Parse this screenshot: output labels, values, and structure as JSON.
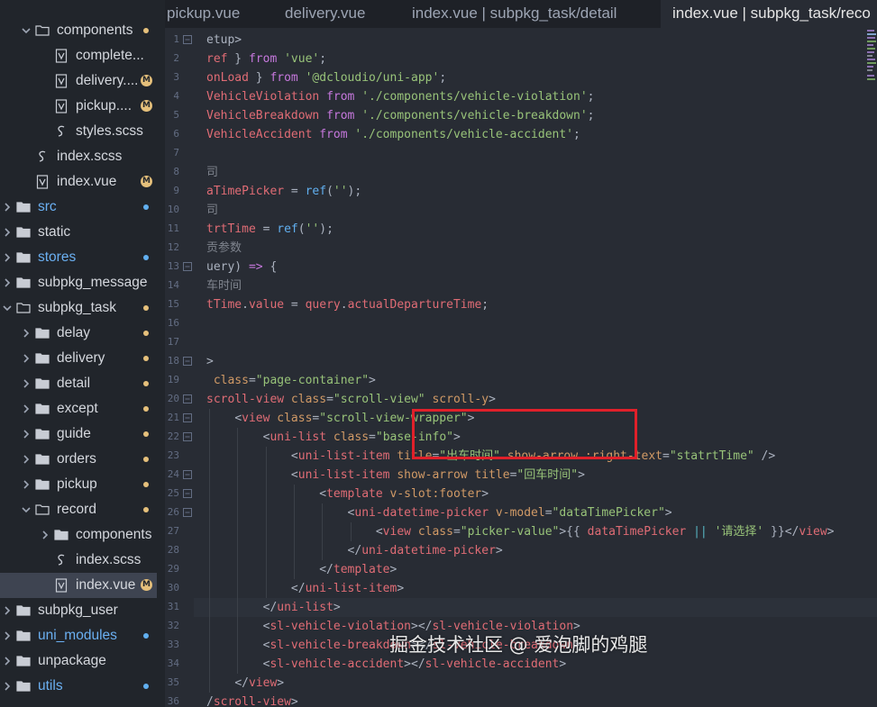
{
  "sidebar": {
    "items": [
      {
        "label": "components",
        "type": "folder",
        "depth": 1,
        "expanded": true,
        "badge": "dot",
        "blue": false
      },
      {
        "label": "complete...",
        "type": "vue",
        "depth": 2,
        "badge": "",
        "blue": false
      },
      {
        "label": "delivery....",
        "type": "vue",
        "depth": 2,
        "badge": "M",
        "blue": false
      },
      {
        "label": "pickup....",
        "type": "vue",
        "depth": 2,
        "badge": "M",
        "blue": false
      },
      {
        "label": "styles.scss",
        "type": "scss",
        "depth": 2,
        "badge": "",
        "blue": false
      },
      {
        "label": "index.scss",
        "type": "scss",
        "depth": 1,
        "badge": "",
        "blue": false
      },
      {
        "label": "index.vue",
        "type": "vue",
        "depth": 1,
        "badge": "M",
        "blue": false
      },
      {
        "label": "src",
        "type": "folder",
        "depth": 0,
        "expanded": false,
        "badge": "blue-dot",
        "blue": true
      },
      {
        "label": "static",
        "type": "folder",
        "depth": 0,
        "expanded": false,
        "badge": "",
        "blue": false
      },
      {
        "label": "stores",
        "type": "folder",
        "depth": 0,
        "expanded": false,
        "badge": "blue-dot",
        "blue": true
      },
      {
        "label": "subpkg_message",
        "type": "folder",
        "depth": 0,
        "expanded": false,
        "badge": "",
        "blue": false
      },
      {
        "label": "subpkg_task",
        "type": "folder",
        "depth": 0,
        "expanded": true,
        "badge": "dot",
        "blue": false
      },
      {
        "label": "delay",
        "type": "folder",
        "depth": 1,
        "expanded": false,
        "badge": "dot",
        "blue": false
      },
      {
        "label": "delivery",
        "type": "folder",
        "depth": 1,
        "expanded": false,
        "badge": "dot",
        "blue": false
      },
      {
        "label": "detail",
        "type": "folder",
        "depth": 1,
        "expanded": false,
        "badge": "dot",
        "blue": false
      },
      {
        "label": "except",
        "type": "folder",
        "depth": 1,
        "expanded": false,
        "badge": "dot",
        "blue": false
      },
      {
        "label": "guide",
        "type": "folder",
        "depth": 1,
        "expanded": false,
        "badge": "dot",
        "blue": false
      },
      {
        "label": "orders",
        "type": "folder",
        "depth": 1,
        "expanded": false,
        "badge": "dot",
        "blue": false
      },
      {
        "label": "pickup",
        "type": "folder",
        "depth": 1,
        "expanded": false,
        "badge": "dot",
        "blue": false
      },
      {
        "label": "record",
        "type": "folder",
        "depth": 1,
        "expanded": true,
        "badge": "dot",
        "blue": false
      },
      {
        "label": "components",
        "type": "folder",
        "depth": 2,
        "expanded": false,
        "badge": "",
        "blue": false
      },
      {
        "label": "index.scss",
        "type": "scss",
        "depth": 2,
        "badge": "",
        "blue": false
      },
      {
        "label": "index.vue",
        "type": "vue",
        "depth": 2,
        "badge": "M",
        "blue": false,
        "selected": true
      },
      {
        "label": "subpkg_user",
        "type": "folder",
        "depth": 0,
        "expanded": false,
        "badge": "",
        "blue": false
      },
      {
        "label": "uni_modules",
        "type": "folder",
        "depth": 0,
        "expanded": false,
        "badge": "blue-dot",
        "blue": true
      },
      {
        "label": "unpackage",
        "type": "folder",
        "depth": 0,
        "expanded": false,
        "badge": "",
        "blue": false
      },
      {
        "label": "utils",
        "type": "folder",
        "depth": 0,
        "expanded": false,
        "badge": "blue-dot",
        "blue": true
      }
    ]
  },
  "tabs": [
    {
      "label": "pickup.vue",
      "active": false
    },
    {
      "label": "delivery.vue",
      "active": false
    },
    {
      "label": "index.vue | subpkg_task/detail",
      "active": false
    },
    {
      "label": "index.vue | subpkg_task/reco",
      "active": true
    }
  ],
  "editor": {
    "lines": [
      {
        "n": "1",
        "fold": true,
        "indent": 0,
        "tokens": [
          [
            "pl",
            "etup>"
          ]
        ]
      },
      {
        "n": "2",
        "fold": false,
        "indent": 0,
        "tokens": [
          [
            "var",
            "ref"
          ],
          [
            "pl",
            " } "
          ],
          [
            "kw",
            "from"
          ],
          [
            "pl",
            " "
          ],
          [
            "str",
            "'vue'"
          ],
          [
            "pl",
            ";"
          ]
        ]
      },
      {
        "n": "3",
        "fold": false,
        "indent": 0,
        "tokens": [
          [
            "var",
            "onLoad"
          ],
          [
            "pl",
            " } "
          ],
          [
            "kw",
            "from"
          ],
          [
            "pl",
            " "
          ],
          [
            "str",
            "'@dcloudio/uni-app'"
          ],
          [
            "pl",
            ";"
          ]
        ]
      },
      {
        "n": "4",
        "fold": false,
        "indent": 0,
        "tokens": [
          [
            "var",
            "VehicleViolation"
          ],
          [
            "pl",
            " "
          ],
          [
            "kw",
            "from"
          ],
          [
            "pl",
            " "
          ],
          [
            "str",
            "'./components/vehicle-violation'"
          ],
          [
            "pl",
            ";"
          ]
        ]
      },
      {
        "n": "5",
        "fold": false,
        "indent": 0,
        "tokens": [
          [
            "var",
            "VehicleBreakdown"
          ],
          [
            "pl",
            " "
          ],
          [
            "kw",
            "from"
          ],
          [
            "pl",
            " "
          ],
          [
            "str",
            "'./components/vehicle-breakdown'"
          ],
          [
            "pl",
            ";"
          ]
        ]
      },
      {
        "n": "6",
        "fold": false,
        "indent": 0,
        "tokens": [
          [
            "var",
            "VehicleAccident"
          ],
          [
            "pl",
            " "
          ],
          [
            "kw",
            "from"
          ],
          [
            "pl",
            " "
          ],
          [
            "str",
            "'./components/vehicle-accident'"
          ],
          [
            "pl",
            ";"
          ]
        ]
      },
      {
        "n": "7",
        "fold": false,
        "indent": 0,
        "tokens": []
      },
      {
        "n": "8",
        "fold": false,
        "indent": 0,
        "tokens": [
          [
            "com",
            "司"
          ]
        ]
      },
      {
        "n": "9",
        "fold": false,
        "indent": 0,
        "tokens": [
          [
            "var",
            "aTimePicker"
          ],
          [
            "pl",
            " = "
          ],
          [
            "fn",
            "ref"
          ],
          [
            "pl",
            "("
          ],
          [
            "str",
            "''"
          ],
          [
            "pl",
            ");"
          ]
        ]
      },
      {
        "n": "10",
        "fold": false,
        "indent": 0,
        "tokens": [
          [
            "com",
            "司"
          ]
        ]
      },
      {
        "n": "11",
        "fold": false,
        "indent": 0,
        "tokens": [
          [
            "var",
            "trtTime"
          ],
          [
            "pl",
            " = "
          ],
          [
            "fn",
            "ref"
          ],
          [
            "pl",
            "("
          ],
          [
            "str",
            "''"
          ],
          [
            "pl",
            ");"
          ]
        ]
      },
      {
        "n": "12",
        "fold": false,
        "indent": 0,
        "tokens": [
          [
            "com",
            "贡参数"
          ]
        ]
      },
      {
        "n": "13",
        "fold": true,
        "indent": 0,
        "tokens": [
          [
            "pl",
            "uery) "
          ],
          [
            "kw",
            "=>"
          ],
          [
            "pl",
            " {"
          ]
        ]
      },
      {
        "n": "14",
        "fold": false,
        "indent": 0,
        "tokens": [
          [
            "com",
            "车时间"
          ]
        ]
      },
      {
        "n": "15",
        "fold": false,
        "indent": 0,
        "tokens": [
          [
            "var",
            "tTime"
          ],
          [
            "pl",
            "."
          ],
          [
            "var",
            "value"
          ],
          [
            "pl",
            " = "
          ],
          [
            "var",
            "query"
          ],
          [
            "pl",
            "."
          ],
          [
            "var",
            "actualDepartureTime"
          ],
          [
            "pl",
            ";"
          ]
        ]
      },
      {
        "n": "16",
        "fold": false,
        "indent": 0,
        "tokens": []
      },
      {
        "n": "17",
        "fold": false,
        "indent": 0,
        "tokens": []
      },
      {
        "n": "18",
        "fold": true,
        "indent": 0,
        "tokens": [
          [
            "pl",
            ">"
          ]
        ]
      },
      {
        "n": "19",
        "fold": false,
        "indent": 0,
        "tokens": [
          [
            "pl",
            " "
          ],
          [
            "attr",
            "class"
          ],
          [
            "pl",
            "="
          ],
          [
            "str",
            "\"page-container\""
          ],
          [
            "pl",
            ">"
          ]
        ]
      },
      {
        "n": "20",
        "fold": true,
        "indent": 0,
        "tokens": [
          [
            "var",
            "scroll-view"
          ],
          [
            "pl",
            " "
          ],
          [
            "attr",
            "class"
          ],
          [
            "pl",
            "="
          ],
          [
            "str",
            "\"scroll-view\""
          ],
          [
            "pl",
            " "
          ],
          [
            "attr",
            "scroll-y"
          ],
          [
            "pl",
            ">"
          ]
        ]
      },
      {
        "n": "21",
        "fold": true,
        "indent": 1,
        "tokens": [
          [
            "pl",
            "<"
          ],
          [
            "var",
            "view"
          ],
          [
            "pl",
            " "
          ],
          [
            "attr",
            "class"
          ],
          [
            "pl",
            "="
          ],
          [
            "str",
            "\"scroll-view-wrapper\""
          ],
          [
            "pl",
            ">"
          ]
        ]
      },
      {
        "n": "22",
        "fold": true,
        "indent": 2,
        "tokens": [
          [
            "pl",
            "<"
          ],
          [
            "var",
            "uni-list"
          ],
          [
            "pl",
            " "
          ],
          [
            "attr",
            "class"
          ],
          [
            "pl",
            "="
          ],
          [
            "str",
            "\"base-info\""
          ],
          [
            "pl",
            ">"
          ]
        ]
      },
      {
        "n": "23",
        "fold": false,
        "indent": 3,
        "tokens": [
          [
            "pl",
            "<"
          ],
          [
            "var",
            "uni-list-item"
          ],
          [
            "pl",
            " "
          ],
          [
            "attr",
            "title"
          ],
          [
            "pl",
            "="
          ],
          [
            "str",
            "\"出车时间\""
          ],
          [
            "pl",
            " "
          ],
          [
            "attr",
            "show-arrow"
          ],
          [
            "pl",
            " "
          ],
          [
            "attr",
            ":right-text"
          ],
          [
            "pl",
            "="
          ],
          [
            "str",
            "\"statrtTime\""
          ],
          [
            "pl",
            " />"
          ]
        ]
      },
      {
        "n": "24",
        "fold": true,
        "indent": 3,
        "tokens": [
          [
            "pl",
            "<"
          ],
          [
            "var",
            "uni-list-item"
          ],
          [
            "pl",
            " "
          ],
          [
            "attr",
            "show-arrow"
          ],
          [
            "pl",
            " "
          ],
          [
            "attr",
            "title"
          ],
          [
            "pl",
            "="
          ],
          [
            "str",
            "\"回车时间\""
          ],
          [
            "pl",
            ">"
          ]
        ]
      },
      {
        "n": "25",
        "fold": true,
        "indent": 4,
        "tokens": [
          [
            "pl",
            "<"
          ],
          [
            "var",
            "template"
          ],
          [
            "pl",
            " "
          ],
          [
            "attr",
            "v-slot:footer"
          ],
          [
            "pl",
            ">"
          ]
        ]
      },
      {
        "n": "26",
        "fold": true,
        "indent": 5,
        "tokens": [
          [
            "pl",
            "<"
          ],
          [
            "var",
            "uni-datetime-picker"
          ],
          [
            "pl",
            " "
          ],
          [
            "attr",
            "v-model"
          ],
          [
            "pl",
            "="
          ],
          [
            "str",
            "\"dataTimePicker\""
          ],
          [
            "pl",
            ">"
          ]
        ]
      },
      {
        "n": "27",
        "fold": false,
        "indent": 6,
        "tokens": [
          [
            "pl",
            "<"
          ],
          [
            "var",
            "view"
          ],
          [
            "pl",
            " "
          ],
          [
            "attr",
            "class"
          ],
          [
            "pl",
            "="
          ],
          [
            "str",
            "\"picker-value\""
          ],
          [
            "pl",
            ">{{ "
          ],
          [
            "var",
            "dataTimePicker"
          ],
          [
            "pl",
            " "
          ],
          [
            "op",
            "||"
          ],
          [
            "pl",
            " "
          ],
          [
            "str",
            "'请选择'"
          ],
          [
            "pl",
            " }}</"
          ],
          [
            "var",
            "view"
          ],
          [
            "pl",
            ">"
          ]
        ]
      },
      {
        "n": "28",
        "fold": false,
        "indent": 5,
        "tokens": [
          [
            "pl",
            "</"
          ],
          [
            "var",
            "uni-datetime-picker"
          ],
          [
            "pl",
            ">"
          ]
        ]
      },
      {
        "n": "29",
        "fold": false,
        "indent": 4,
        "tokens": [
          [
            "pl",
            "</"
          ],
          [
            "var",
            "template"
          ],
          [
            "pl",
            ">"
          ]
        ]
      },
      {
        "n": "30",
        "fold": false,
        "indent": 3,
        "tokens": [
          [
            "pl",
            "</"
          ],
          [
            "var",
            "uni-list-item"
          ],
          [
            "pl",
            ">"
          ]
        ]
      },
      {
        "n": "31",
        "fold": false,
        "indent": 2,
        "tokens": [
          [
            "pl",
            "</"
          ],
          [
            "var",
            "uni-list"
          ],
          [
            "pl",
            ">"
          ]
        ]
      },
      {
        "n": "32",
        "fold": false,
        "indent": 2,
        "tokens": [
          [
            "pl",
            "<"
          ],
          [
            "var",
            "sl-vehicle-violation"
          ],
          [
            "pl",
            "></"
          ],
          [
            "var",
            "sl-vehicle-violation"
          ],
          [
            "pl",
            ">"
          ]
        ]
      },
      {
        "n": "33",
        "fold": false,
        "indent": 2,
        "tokens": [
          [
            "pl",
            "<"
          ],
          [
            "var",
            "sl-vehicle-breakdown"
          ],
          [
            "pl",
            "></"
          ],
          [
            "var",
            "sl-vehicle-breakdown"
          ],
          [
            "pl",
            ">"
          ]
        ]
      },
      {
        "n": "34",
        "fold": false,
        "indent": 2,
        "tokens": [
          [
            "pl",
            "<"
          ],
          [
            "var",
            "sl-vehicle-accident"
          ],
          [
            "pl",
            "></"
          ],
          [
            "var",
            "sl-vehicle-accident"
          ],
          [
            "pl",
            ">"
          ]
        ]
      },
      {
        "n": "35",
        "fold": false,
        "indent": 1,
        "tokens": [
          [
            "pl",
            "</"
          ],
          [
            "var",
            "view"
          ],
          [
            "pl",
            ">"
          ]
        ]
      },
      {
        "n": "36",
        "fold": false,
        "indent": 0,
        "tokens": [
          [
            "pl",
            "/"
          ],
          [
            "var",
            "scroll-view"
          ],
          [
            "pl",
            ">"
          ]
        ]
      }
    ]
  },
  "watermark": "掘金技术社区 @ 爱泡脚的鸡腿",
  "colors": {
    "sidebar_bg": "#21252b",
    "editor_bg": "#282c34",
    "highlight_box": "#e0202a",
    "modified_badge": "#e5c07b",
    "blue_text": "#6bb0f2",
    "dot_yellow": "#e5c07b",
    "dot_blue": "#61afef"
  }
}
